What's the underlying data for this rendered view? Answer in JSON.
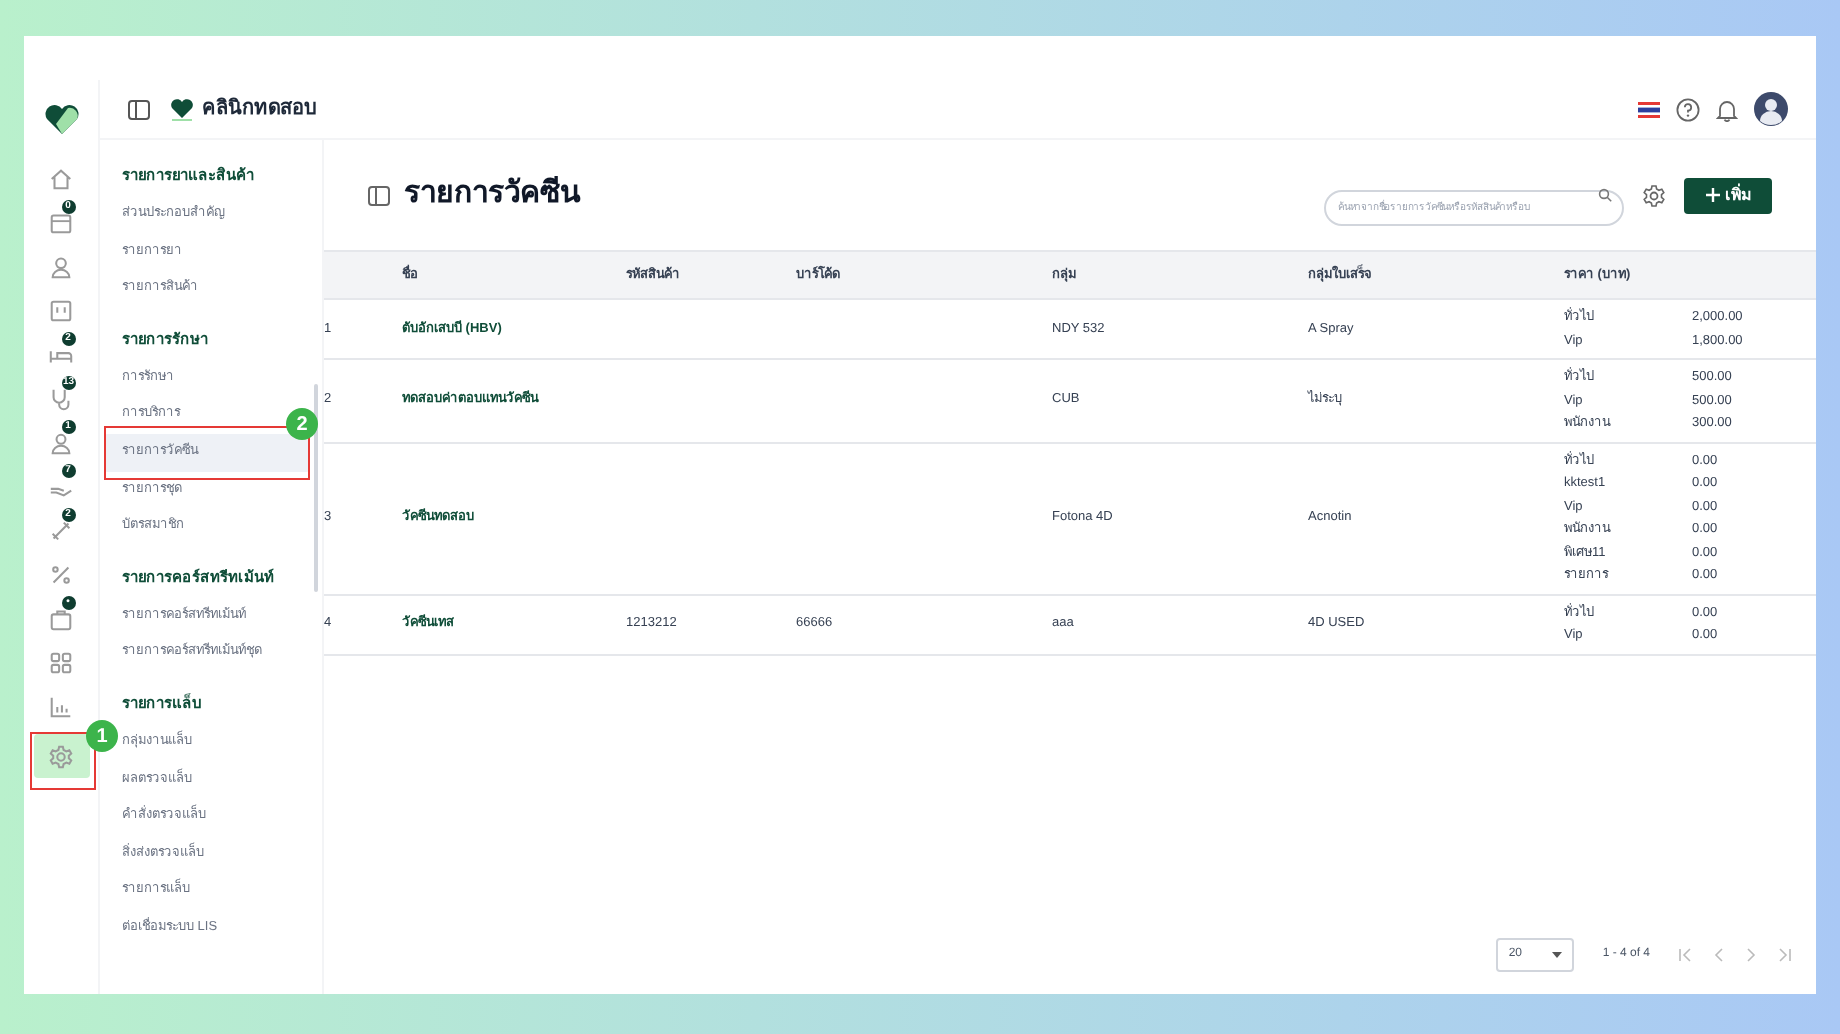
{
  "app": {
    "clinic_name": "คลินิกทดสอบ"
  },
  "rail": [
    {
      "selected": false
    },
    {
      "badge": "0",
      "selected": false
    },
    {
      "selected": false
    },
    {
      "selected": false
    },
    {
      "badge": "2",
      "selected": false
    },
    {
      "badge": "13",
      "selected": false
    },
    {
      "badge": "1",
      "selected": false
    },
    {
      "badge": "7",
      "selected": false
    },
    {
      "badge": "2",
      "selected": false
    },
    {
      "selected": false
    },
    {
      "badge": "•",
      "selected": false
    },
    {
      "selected": false
    },
    {
      "selected": false
    },
    {
      "selected": true
    }
  ],
  "submenu": [
    {
      "title": "รายการยาและสินค้า",
      "items": [
        {
          "label": "ส่วนประกอบสำคัญ",
          "selected": false
        },
        {
          "label": "รายการยา",
          "selected": false
        },
        {
          "label": "รายการสินค้า",
          "selected": false
        }
      ]
    },
    {
      "title": "รายการรักษา",
      "items": [
        {
          "label": "การรักษา",
          "selected": false
        },
        {
          "label": "การบริการ",
          "selected": false
        },
        {
          "label": "รายการวัคซีน",
          "selected": true
        },
        {
          "label": "รายการชุด",
          "selected": false
        },
        {
          "label": "บัตรสมาชิก",
          "selected": false
        }
      ]
    },
    {
      "title": "รายการคอร์สทรีทเม้นท์",
      "items": [
        {
          "label": "รายการคอร์สทรีทเม้นท์",
          "selected": false
        },
        {
          "label": "รายการคอร์สทรีทเม้นท์ชุด",
          "selected": false
        }
      ]
    },
    {
      "title": "รายการแล็บ",
      "items": [
        {
          "label": "กลุ่มงานแล็บ",
          "selected": false
        },
        {
          "label": "ผลตรวจแล็บ",
          "selected": false
        },
        {
          "label": "คำสั่งตรวจแล็บ",
          "selected": false
        },
        {
          "label": "สิ่งส่งตรวจแล็บ",
          "selected": false
        },
        {
          "label": "รายการแล็บ",
          "selected": false
        },
        {
          "label": "ต่อเชื่อมระบบ LIS",
          "selected": false
        }
      ]
    }
  ],
  "page": {
    "title": "รายการวัคซีน",
    "search": {
      "placeholder": "ค้นหาจากชื่อรายการวัคซีนหรือรหัสสินค้าหรือบ"
    },
    "add_button": "เพิ่ม"
  },
  "table": {
    "columns": [
      "ชื่อ",
      "รหัสสินค้า",
      "บาร์โค้ด",
      "กลุ่ม",
      "กลุ่มใบเสร็จ",
      "ราคา (บาท)"
    ],
    "rows": [
      {
        "no": "1",
        "name": "ตับอักเสบบี (HBV)",
        "group": "NDY 532",
        "receipt_group": "A Spray",
        "prices": [
          {
            "tier": "ทั่วไป",
            "amount": "2,000.00"
          },
          {
            "tier": "Vip",
            "amount": "1,800.00"
          }
        ]
      },
      {
        "no": "2",
        "name": "ทดสอบค่าตอบแทนวัคซีน",
        "group": "CUB",
        "receipt_group": "ไม่ระบุ",
        "prices": [
          {
            "tier": "ทั่วไป",
            "amount": "500.00"
          },
          {
            "tier": "Vip",
            "amount": "500.00"
          },
          {
            "tier": "พนักงาน",
            "amount": "300.00"
          }
        ]
      },
      {
        "no": "3",
        "name": "วัคซีนทดสอบ",
        "group": "Fotona 4D",
        "receipt_group": "Acnotin",
        "prices": [
          {
            "tier": "ทั่วไป",
            "amount": "0.00"
          },
          {
            "tier": "kktest1",
            "amount": "0.00"
          },
          {
            "tier": "Vip",
            "amount": "0.00"
          },
          {
            "tier": "พนักงาน",
            "amount": "0.00"
          },
          {
            "tier": "พิเศษ11",
            "amount": "0.00"
          },
          {
            "tier": "รายการ",
            "amount": "0.00"
          }
        ]
      },
      {
        "no": "4",
        "name": "วัคซีนเทส",
        "code": "1213212",
        "barcode": "66666",
        "group": "aaa",
        "receipt_group": "4D USED",
        "prices": [
          {
            "tier": "ทั่วไป",
            "amount": "0.00"
          },
          {
            "tier": "Vip",
            "amount": "0.00"
          }
        ]
      }
    ]
  },
  "pagination": {
    "page_size": "20",
    "range": "1 - 4 of 4"
  },
  "callouts": [
    {
      "number": "1"
    },
    {
      "number": "2"
    }
  ]
}
